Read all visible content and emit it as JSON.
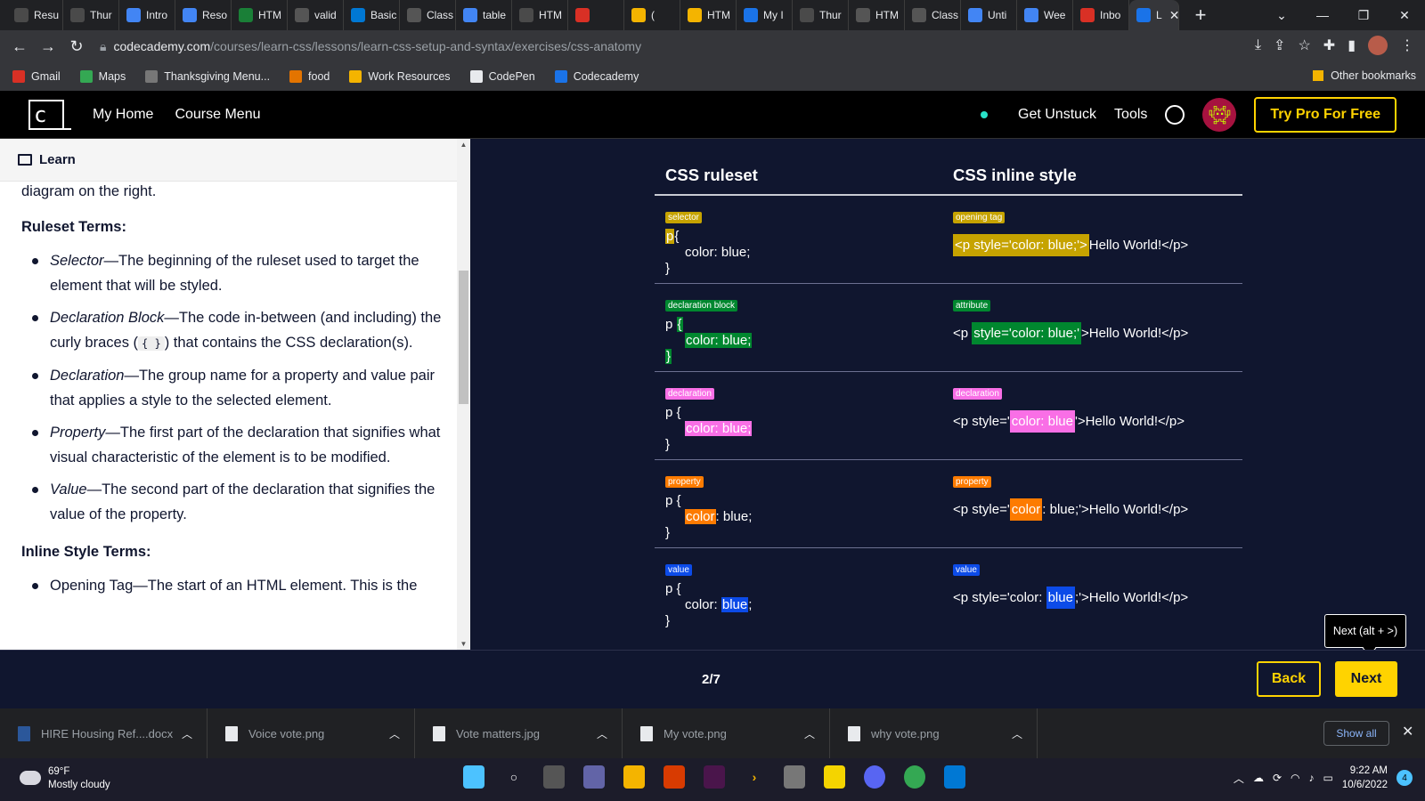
{
  "browser": {
    "tabs": [
      {
        "label": "Resu",
        "color": "#4a4a4a"
      },
      {
        "label": "Thur",
        "color": "#4a4a4a"
      },
      {
        "label": "Intro",
        "color": "#4285f4"
      },
      {
        "label": "Reso",
        "color": "#4285f4"
      },
      {
        "label": "HTM",
        "color": "#1a7f37"
      },
      {
        "label": "valid",
        "color": "#555"
      },
      {
        "label": "Basic",
        "color": "#0078d4"
      },
      {
        "label": "Class",
        "color": "#555"
      },
      {
        "label": "table",
        "color": "#4285f4"
      },
      {
        "label": "HTM",
        "color": "#4a4a4a"
      },
      {
        "label": "",
        "color": "#d93025"
      },
      {
        "label": "(",
        "color": "#f4b400"
      },
      {
        "label": "HTM",
        "color": "#f4b400"
      },
      {
        "label": "My I",
        "color": "#1a73e8"
      },
      {
        "label": "Thur",
        "color": "#4a4a4a"
      },
      {
        "label": "HTM",
        "color": "#555"
      },
      {
        "label": "Class",
        "color": "#555"
      },
      {
        "label": "Unti",
        "color": "#4285f4"
      },
      {
        "label": "Wee",
        "color": "#4285f4"
      },
      {
        "label": "Inbo",
        "color": "#d93025"
      }
    ],
    "active_tab": "L",
    "url_host": "codecademy.com",
    "url_path": "/courses/learn-css/lessons/learn-css-setup-and-syntax/exercises/css-anatomy",
    "bookmarks": [
      {
        "label": "Gmail",
        "color": "#d93025"
      },
      {
        "label": "Maps",
        "color": "#34a853"
      },
      {
        "label": "Thanksgiving Menu...",
        "color": "#777"
      },
      {
        "label": "food",
        "color": "#e37400"
      },
      {
        "label": "Work Resources",
        "color": "#f4b400"
      },
      {
        "label": "CodePen",
        "color": "#e8eaed"
      },
      {
        "label": "Codecademy",
        "color": "#1a73e8"
      }
    ],
    "other_bookmarks": "Other bookmarks"
  },
  "header": {
    "my_home": "My Home",
    "course_menu": "Course Menu",
    "get_unstuck": "Get Unstuck",
    "tools": "Tools",
    "try_pro": "Try Pro For Free"
  },
  "learn": {
    "tab_label": "Learn",
    "intro_tail": "diagram on the right.",
    "ruleset_heading": "Ruleset Terms:",
    "ruleset_terms": [
      {
        "term": "Selector",
        "desc": "—The beginning of the ruleset used to target the element that will be styled."
      },
      {
        "term": "Declaration Block",
        "desc_a": "—The code in-between (and including) the curly braces (",
        "code": "{ }",
        "desc_b": ") that contains the CSS declaration(s)."
      },
      {
        "term": "Declaration",
        "desc": "—The group name for a property and value pair that applies a style to the selected element."
      },
      {
        "term": "Property",
        "desc": "—The first part of the declaration that signifies what visual characteristic of the element is to be modified."
      },
      {
        "term": "Value",
        "desc": "—The second part of the declaration that signifies the value of the property."
      }
    ],
    "inline_heading": "Inline Style Terms:",
    "inline_partial": "Opening Tag—The start of an HTML element. This is the"
  },
  "diagram": {
    "col_ruleset": "CSS ruleset",
    "col_inline": "CSS inline style",
    "rows": [
      {
        "tag_left": "selector",
        "tag_right": "opening tag",
        "color": "#c6a300"
      },
      {
        "tag_left": "declaration block",
        "tag_right": "attribute",
        "color": "#00872f"
      },
      {
        "tag_left": "declaration",
        "tag_right": "declaration",
        "color": "#f96fe6"
      },
      {
        "tag_left": "property",
        "tag_right": "property",
        "color": "#fd7b00"
      },
      {
        "tag_left": "value",
        "tag_right": "value",
        "color": "#0c4be8"
      }
    ],
    "code": {
      "p": "p",
      "brace_open": "{",
      "brace_close": "}",
      "decl": "color: blue;",
      "decl_noscolon": "color: blue",
      "prop": "color",
      "val": "blue",
      "open_tag": "<p style='color: blue;'>",
      "hello_close": "Hello World!</p>",
      "p_open": "<p ",
      "attr": "style='color: blue;'",
      "gt_hello": ">Hello World!</p>",
      "p_style_q": "<p style='",
      "q_hello": "'>Hello World!</p>",
      "colon_blue": ": blue;'>Hello World!</p>",
      "p_style_color": "<p style='color: ",
      "semi_hello": ";'>Hello World!</p>",
      "colon_sp": ": ",
      "blue_semi": ": blue;",
      "semi": ";"
    }
  },
  "footer": {
    "pager": "2/7",
    "back": "Back",
    "next": "Next",
    "next_tooltip": "Next (alt + >)"
  },
  "downloads": {
    "items": [
      "HIRE Housing Ref....docx",
      "Voice vote.png",
      "Vote matters.jpg",
      "My vote.png",
      "why vote.png"
    ],
    "show_all": "Show all"
  },
  "taskbar": {
    "temp": "69°F",
    "weather": "Mostly cloudy",
    "time": "9:22 AM",
    "date": "10/6/2022",
    "notifications": "4"
  }
}
